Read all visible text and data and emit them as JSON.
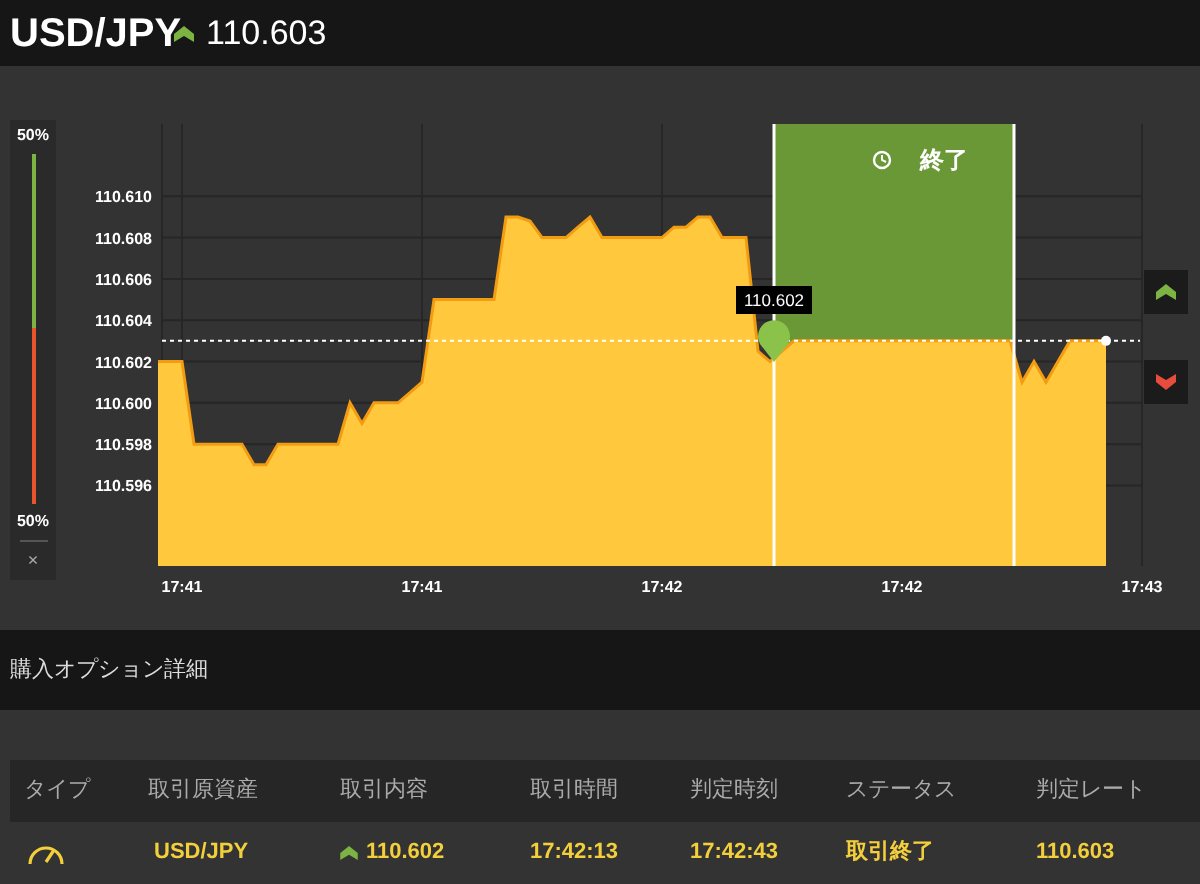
{
  "header": {
    "symbol": "USD/JPY",
    "price": "110.603"
  },
  "sentiment": {
    "top_label": "50%",
    "bottom_label": "50%",
    "level": 0.5,
    "close": "×"
  },
  "chart": {
    "tooltip": "110.602",
    "expiry_label": "終了",
    "chart_data": {
      "type": "area",
      "categories": [
        null,
        null,
        "17:41",
        null,
        null,
        null,
        null,
        null,
        null,
        null,
        null,
        null,
        null,
        null,
        null,
        null,
        null,
        null,
        null,
        null,
        null,
        null,
        "17:41",
        null,
        null,
        null,
        null,
        null,
        null,
        null,
        null,
        null,
        null,
        null,
        null,
        null,
        null,
        null,
        null,
        null,
        null,
        null,
        "17:42",
        null,
        null,
        null,
        null,
        null,
        null,
        null,
        null,
        null,
        null,
        null,
        null,
        null,
        null,
        null,
        null,
        null,
        null,
        null,
        "17:42",
        null,
        null,
        null,
        null,
        null,
        null,
        null,
        null,
        null,
        null,
        null,
        null,
        null,
        null,
        null,
        null,
        null,
        null,
        null,
        "17:43"
      ],
      "series": [
        {
          "color": "#ffc83d",
          "values": [
            110.602,
            110.602,
            110.602,
            110.598,
            110.598,
            110.598,
            110.598,
            110.598,
            110.597,
            110.597,
            110.598,
            110.598,
            110.598,
            110.598,
            110.598,
            110.598,
            110.6,
            110.599,
            110.6,
            110.6,
            110.6,
            110.6005,
            110.601,
            110.605,
            110.605,
            110.605,
            110.605,
            110.605,
            110.605,
            110.609,
            110.609,
            110.6088,
            110.608,
            110.608,
            110.608,
            110.6085,
            110.609,
            110.608,
            110.608,
            110.608,
            110.608,
            110.608,
            110.608,
            110.6085,
            110.6085,
            110.609,
            110.609,
            110.608,
            110.608,
            110.608,
            110.6025,
            110.602,
            null,
            110.603,
            110.603,
            110.603,
            110.603,
            110.603,
            110.603,
            110.603,
            110.603,
            110.603,
            110.603,
            110.603,
            110.603,
            110.603,
            110.603,
            110.603,
            110.603,
            110.603,
            110.603,
            110.603,
            110.601,
            110.602,
            110.601,
            110.602,
            110.603,
            110.603,
            110.603,
            110.603,
            null,
            null,
            null
          ]
        }
      ],
      "ylim": [
        110.5921,
        110.6135
      ],
      "grid": true,
      "ref_lines": [
        {
          "axis": "y",
          "value": 110.603
        }
      ],
      "yticks": [
        {
          "value": 110.596,
          "label": "110.596"
        },
        {
          "value": 110.598,
          "label": "110.598"
        },
        {
          "value": 110.6,
          "label": "110.600"
        },
        {
          "value": 110.602,
          "label": "110.602"
        },
        {
          "value": 110.604,
          "label": "110.604"
        },
        {
          "value": 110.606,
          "label": "110.606"
        },
        {
          "value": 110.608,
          "label": "110.608"
        },
        {
          "value": 110.61,
          "label": "110.610"
        }
      ]
    }
  },
  "section_title": "購入オプション詳細",
  "table": {
    "columns": [
      "タイプ",
      "取引原資産",
      "取引内容",
      "取引時間",
      "判定時刻",
      "ステータス",
      "判定レート"
    ],
    "rows": [
      {
        "asset": "USD/JPY",
        "rate": "110.602",
        "trade_time": "17:42:13",
        "judge_time": "17:42:43",
        "status": "取引終了",
        "judge_rate": "110.603"
      }
    ]
  }
}
